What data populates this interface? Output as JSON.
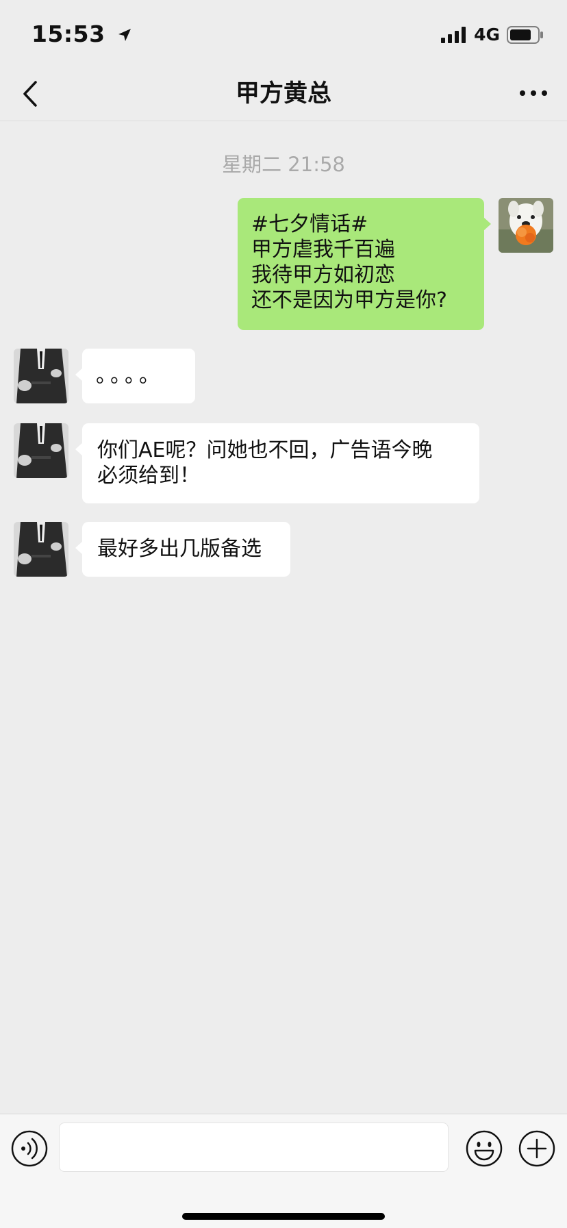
{
  "status_bar": {
    "time": "15:53",
    "network": "4G"
  },
  "nav": {
    "title": "甲方黄总"
  },
  "chat": {
    "timestamp": "星期二 21:58",
    "messages": [
      {
        "sender": "me",
        "lines": [
          "#七夕情话#",
          "甲方虐我千百遍",
          "我待甲方如初恋",
          "还不是因为甲方是你?"
        ]
      },
      {
        "sender": "contact",
        "lines": [
          "。。。。"
        ]
      },
      {
        "sender": "contact",
        "lines": [
          "你们AE呢？问她也不回，广告语今晚",
          "必须给到！"
        ]
      },
      {
        "sender": "contact",
        "lines": [
          "最好多出几版备选"
        ]
      }
    ]
  },
  "input_bar": {
    "text_value": ""
  },
  "colors": {
    "background": "#ededed",
    "outgoing_bubble": "#a9e87a",
    "incoming_bubble": "#ffffff",
    "timestamp_text": "#a9a9a9"
  },
  "icons": {
    "status": [
      "location-arrow-icon",
      "signal-icon",
      "battery-icon"
    ],
    "nav": [
      "back-chevron-icon",
      "more-icon"
    ],
    "input": [
      "voice-icon",
      "emoji-icon",
      "plus-icon"
    ]
  }
}
